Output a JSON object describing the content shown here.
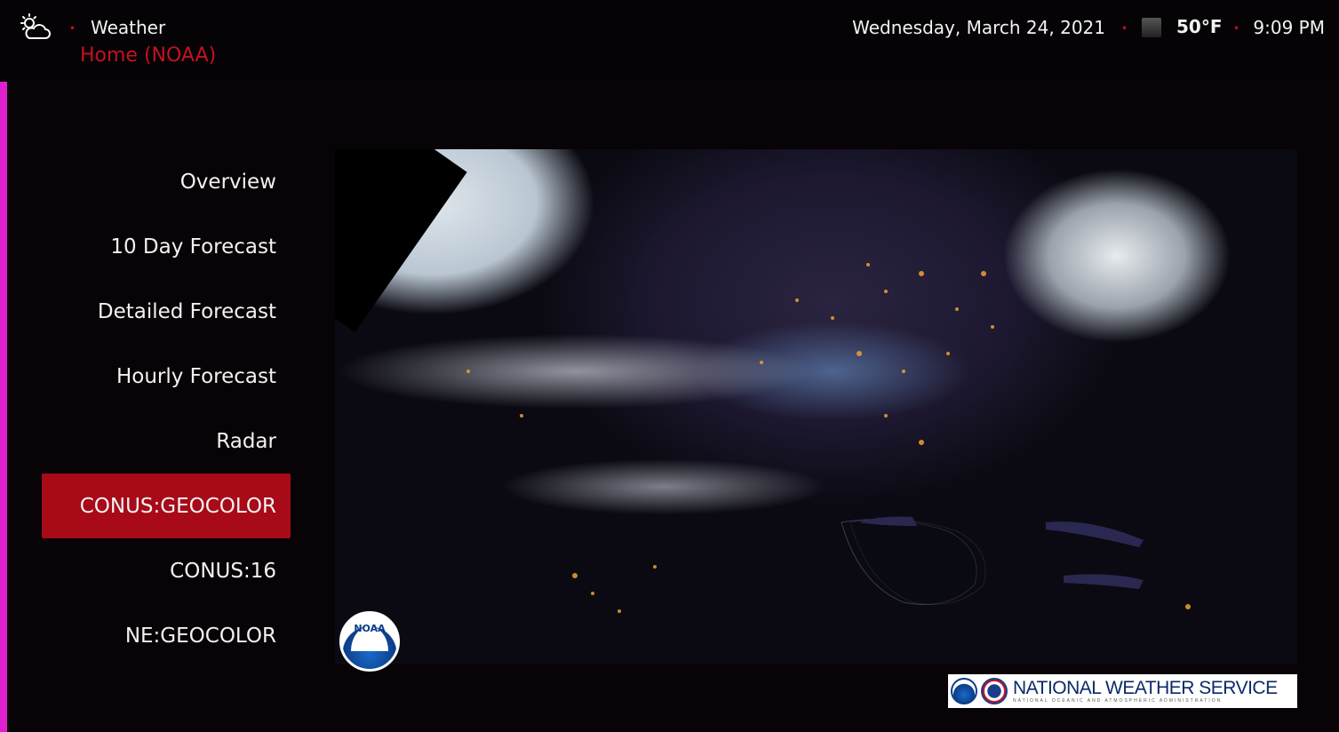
{
  "header": {
    "app_icon": "partly-cloudy-night-icon",
    "app_title": "Weather",
    "breadcrumb": "Home (NOAA)",
    "date": "Wednesday, March 24, 2021",
    "weather_icon": "current-conditions-icon",
    "temperature": "50°F",
    "time": "9:09 PM",
    "separator_color": "#c4121f"
  },
  "menu": {
    "items": [
      {
        "label": "Overview",
        "active": false
      },
      {
        "label": "10 Day Forecast",
        "active": false
      },
      {
        "label": "Detailed Forecast",
        "active": false
      },
      {
        "label": "Hourly Forecast",
        "active": false
      },
      {
        "label": "Radar",
        "active": false
      },
      {
        "label": "CONUS:GEOCOLOR",
        "active": true
      },
      {
        "label": "CONUS:16",
        "active": false
      },
      {
        "label": "NE:GEOCOLOR",
        "active": false
      }
    ],
    "active_color": "#a80a18"
  },
  "main": {
    "image_name": "satellite-image-conus-geocolor",
    "logo_text": "NOAA"
  },
  "footer": {
    "nws_title": "NATIONAL WEATHER SERVICE",
    "nws_subtitle": "NATIONAL OCEANIC AND ATMOSPHERIC ADMINISTRATION"
  }
}
